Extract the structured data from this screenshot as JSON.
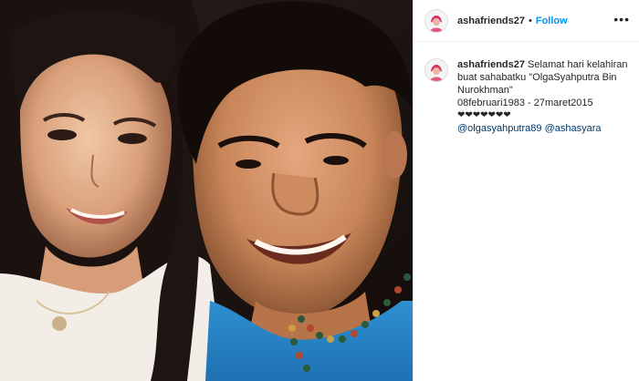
{
  "post": {
    "username": "ashafriends27",
    "separator": "•",
    "follow_label": "Follow",
    "more_icon": "ellipsis-icon",
    "caption": {
      "username": "ashafriends27",
      "text_line1": "Selamat hari kelahiran buat sahabatku \"OlgaSyahputra Bin Nurokhman\"",
      "text_line2": "08februari1983 - 27maret2015",
      "hearts": "❤❤❤❤❤❤❤",
      "mention1": "@olgasyahputra89",
      "mention2": "@ashasyara"
    }
  },
  "photo": {
    "description_icon": "photo-image"
  },
  "colors": {
    "link": "#00376b",
    "follow": "#0095f6",
    "border": "#efefef"
  }
}
